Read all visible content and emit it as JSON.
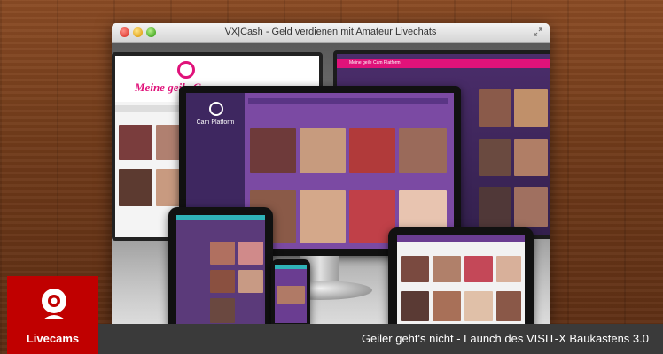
{
  "window": {
    "title": "VX|Cash - Geld verdienen mit Amateur Livechats"
  },
  "colors": {
    "brand_red": "#c00000",
    "caption_bg": "#3a3a3a",
    "screen_purple": "#4b2d6b",
    "accent_pink": "#e0127a"
  },
  "screens": {
    "left_heading": "Meine geile C",
    "desktop_brand": "Cam Platform",
    "right_heading": "Meine geile Cam Platform"
  },
  "banner": {
    "label": "Livecams",
    "icon": "webcam-icon",
    "caption": "Geiler geht's nicht - Launch des VISIT-X Baukastens 3.0"
  }
}
